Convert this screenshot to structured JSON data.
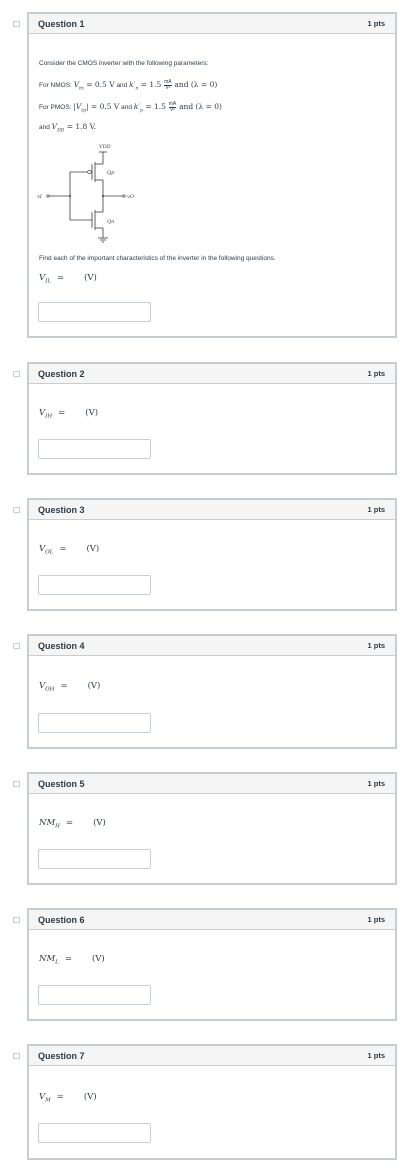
{
  "pts_label": "1 pts",
  "q1": {
    "title": "Question 1",
    "intro": "Consider the CMOS inverter with the following parameters:",
    "nmos_label": "For NMOS:",
    "nmos_vt": "= 0.5 V",
    "and1": "and",
    "kn_val": "= 1.5",
    "and_lambda1": "and (λ = 0)",
    "pmos_label": "For PMOS:",
    "pmos_vt": "= 0.5 V",
    "and2": "and",
    "kp_val": "= 1.5",
    "and_lambda2": "and (λ = 0)",
    "vdd_prefix": "and",
    "vdd_val": "= 1.8 V.",
    "frac_num": "mA",
    "frac_den": "V²",
    "circuit": {
      "vdd_label": "VDD",
      "qp_label": "Qp",
      "qn_label": "Qn",
      "vi_label": "vI",
      "vo_label": "vO"
    },
    "instruction": "Find each of the important characteristics of the inverter in the following questions.",
    "prompt_sym": "V",
    "prompt_sub": "IL",
    "prompt_eq": "=",
    "prompt_unit": "(V)"
  },
  "questions": [
    {
      "title": "Question 2",
      "sym": "V",
      "sub": "IH",
      "eq": "=",
      "unit": "(V)"
    },
    {
      "title": "Question 3",
      "sym": "V",
      "sub": "OL",
      "eq": "=",
      "unit": "(V)"
    },
    {
      "title": "Question 4",
      "sym": "V",
      "sub": "OH",
      "eq": "=",
      "unit": "(V)"
    },
    {
      "title": "Question 5",
      "sym": "NM",
      "sub": "H",
      "eq": "=",
      "unit": "(V)"
    },
    {
      "title": "Question 6",
      "sym": "NM",
      "sub": "L",
      "eq": "=",
      "unit": "(V)"
    },
    {
      "title": "Question 7",
      "sym": "V",
      "sub": "M",
      "eq": "=",
      "unit": "(V)"
    }
  ]
}
